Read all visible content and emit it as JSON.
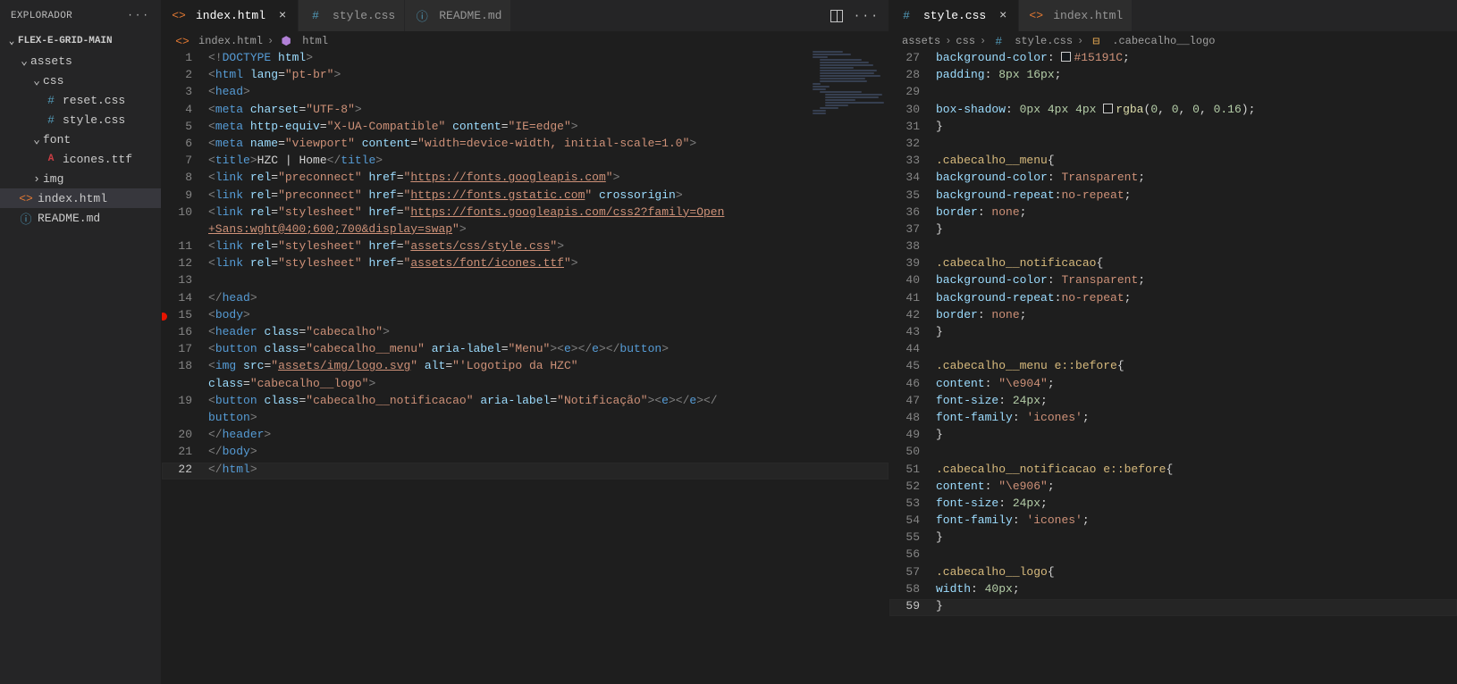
{
  "sidebar": {
    "title": "EXPLORADOR",
    "projectName": "FLEX-E-GRID-MAIN",
    "tree": [
      {
        "type": "folder",
        "name": "assets",
        "indent": 1,
        "open": true
      },
      {
        "type": "folder",
        "name": "css",
        "indent": 2,
        "open": true
      },
      {
        "type": "file",
        "name": "reset.css",
        "icon": "css",
        "indent": 3
      },
      {
        "type": "file",
        "name": "style.css",
        "icon": "css",
        "indent": 3
      },
      {
        "type": "folder",
        "name": "font",
        "indent": 2,
        "open": true
      },
      {
        "type": "file",
        "name": "icones.ttf",
        "icon": "font",
        "indent": 3
      },
      {
        "type": "folder",
        "name": "img",
        "indent": 2,
        "open": false
      },
      {
        "type": "file",
        "name": "index.html",
        "icon": "html",
        "indent": 1,
        "active": true
      },
      {
        "type": "file",
        "name": "README.md",
        "icon": "readme",
        "indent": 1
      }
    ]
  },
  "leftPane": {
    "tabs": [
      {
        "name": "index.html",
        "icon": "html",
        "active": true,
        "close": true
      },
      {
        "name": "style.css",
        "icon": "css",
        "active": false,
        "close": false
      },
      {
        "name": "README.md",
        "icon": "readme",
        "active": false,
        "close": false
      }
    ],
    "breadcrumb": [
      {
        "icon": "html",
        "text": "index.html"
      },
      {
        "icon": "cube",
        "text": "html"
      }
    ],
    "lines": [
      {
        "n": 1,
        "html": "<span class=t-gray>&lt;!</span><span class=t-blue>DOCTYPE</span> <span class=t-attr>html</span><span class=t-gray>&gt;</span>"
      },
      {
        "n": 2,
        "html": "<span class=t-gray>&lt;</span><span class=t-blue>html</span> <span class=t-attr>lang</span><span class=t-white>=</span><span class=t-str>\"pt-br\"</span><span class=t-gray>&gt;</span>"
      },
      {
        "n": 3,
        "html": "<span class=t-gray>&lt;</span><span class=t-blue>head</span><span class=t-gray>&gt;</span>"
      },
      {
        "n": 4,
        "html": "    <span class=t-gray>&lt;</span><span class=t-blue>meta</span> <span class=t-attr>charset</span><span class=t-white>=</span><span class=t-str>\"UTF-8\"</span><span class=t-gray>&gt;</span>"
      },
      {
        "n": 5,
        "html": "    <span class=t-gray>&lt;</span><span class=t-blue>meta</span> <span class=t-attr>http-equiv</span><span class=t-white>=</span><span class=t-str>\"X-UA-Compatible\"</span> <span class=t-attr>content</span><span class=t-white>=</span><span class=t-str>\"IE=edge\"</span><span class=t-gray>&gt;</span>"
      },
      {
        "n": 6,
        "html": "    <span class=t-gray>&lt;</span><span class=t-blue>meta</span> <span class=t-attr>name</span><span class=t-white>=</span><span class=t-str>\"viewport\"</span> <span class=t-attr>content</span><span class=t-white>=</span><span class=t-str>\"width=device-width, initial-scale=1.0\"</span><span class=t-gray>&gt;</span>"
      },
      {
        "n": 7,
        "html": "    <span class=t-gray>&lt;</span><span class=t-blue>title</span><span class=t-gray>&gt;</span><span class=t-white>HZC | Home</span><span class=t-gray>&lt;/</span><span class=t-blue>title</span><span class=t-gray>&gt;</span>"
      },
      {
        "n": 8,
        "html": "    <span class=t-gray>&lt;</span><span class=t-blue>link</span> <span class=t-attr>rel</span><span class=t-white>=</span><span class=t-str>\"preconnect\"</span> <span class=t-attr>href</span><span class=t-white>=</span><span class=t-str>\"</span><span class=t-link>https://fonts.googleapis.com</span><span class=t-str>\"</span><span class=t-gray>&gt;</span>"
      },
      {
        "n": 9,
        "html": "    <span class=t-gray>&lt;</span><span class=t-blue>link</span> <span class=t-attr>rel</span><span class=t-white>=</span><span class=t-str>\"preconnect\"</span> <span class=t-attr>href</span><span class=t-white>=</span><span class=t-str>\"</span><span class=t-link>https://fonts.gstatic.com</span><span class=t-str>\"</span> <span class=t-attr>crossorigin</span><span class=t-gray>&gt;</span>"
      },
      {
        "n": 10,
        "html": "    <span class=t-gray>&lt;</span><span class=t-blue>link</span> <span class=t-attr>rel</span><span class=t-white>=</span><span class=t-str>\"stylesheet\"</span> <span class=t-attr>href</span><span class=t-white>=</span><span class=t-str>\"</span><span class=t-link>https://fonts.googleapis.com/css2?family=Open</span>"
      },
      {
        "n": "",
        "html": "    <span class=t-link>+Sans:wght@400;600;700&amp;display=swap</span><span class=t-str>\"</span><span class=t-gray>&gt;</span>"
      },
      {
        "n": 11,
        "html": "    <span class=t-gray>&lt;</span><span class=t-blue>link</span> <span class=t-attr>rel</span><span class=t-white>=</span><span class=t-str>\"stylesheet\"</span> <span class=t-attr>href</span><span class=t-white>=</span><span class=t-str>\"</span><span class=t-link>assets/css/style.css</span><span class=t-str>\"</span><span class=t-gray>&gt;</span>"
      },
      {
        "n": 12,
        "html": "    <span class=t-gray>&lt;</span><span class=t-blue>link</span> <span class=t-attr>rel</span><span class=t-white>=</span><span class=t-str>\"stylesheet\"</span> <span class=t-attr>href</span><span class=t-white>=</span><span class=t-str>\"</span><span class=t-link>assets/font/icones.ttf</span><span class=t-str>\"</span><span class=t-gray>&gt;</span>"
      },
      {
        "n": 13,
        "html": ""
      },
      {
        "n": 14,
        "html": "<span class=t-gray>&lt;/</span><span class=t-blue>head</span><span class=t-gray>&gt;</span>"
      },
      {
        "n": 15,
        "html": "<span class=t-gray>&lt;</span><span class=t-blue>body</span><span class=t-gray>&gt;</span>",
        "bp": true
      },
      {
        "n": 16,
        "html": "    <span class=t-gray>&lt;</span><span class=t-blue>header</span> <span class=t-attr>class</span><span class=t-white>=</span><span class=t-str>\"cabecalho\"</span><span class=t-gray>&gt;</span>"
      },
      {
        "n": 17,
        "html": "        <span class=t-gray>&lt;</span><span class=t-blue>button</span> <span class=t-attr>class</span><span class=t-white>=</span><span class=t-str>\"cabecalho__menu\"</span> <span class=t-attr>aria-label</span><span class=t-white>=</span><span class=t-str>\"Menu\"</span><span class=t-gray>&gt;&lt;</span><span class=t-blue>e</span><span class=t-gray>&gt;&lt;/</span><span class=t-blue>e</span><span class=t-gray>&gt;&lt;/</span><span class=t-blue>button</span><span class=t-gray>&gt;</span>"
      },
      {
        "n": 18,
        "html": "        <span class=t-gray>&lt;</span><span class=t-blue>img</span> <span class=t-attr>src</span><span class=t-white>=</span><span class=t-str>\"</span><span class=t-link>assets/img/logo.svg</span><span class=t-str>\"</span> <span class=t-attr>alt</span><span class=t-white>=</span><span class=t-str>\"'Logotipo da HZC\"</span> "
      },
      {
        "n": "",
        "html": "        <span class=t-attr>class</span><span class=t-white>=</span><span class=t-str>\"cabecalho__logo\"</span><span class=t-gray>&gt;</span>"
      },
      {
        "n": 19,
        "html": "        <span class=t-gray>&lt;</span><span class=t-blue>button</span> <span class=t-attr>class</span><span class=t-white>=</span><span class=t-str>\"cabecalho__notificacao\"</span> <span class=t-attr>aria-label</span><span class=t-white>=</span><span class=t-str>\"Notificação\"</span><span class=t-gray>&gt;&lt;</span><span class=t-blue>e</span><span class=t-gray>&gt;&lt;/</span><span class=t-blue>e</span><span class=t-gray>&gt;&lt;/</span>"
      },
      {
        "n": "",
        "html": "        <span class=t-blue>button</span><span class=t-gray>&gt;</span>"
      },
      {
        "n": 20,
        "html": "    <span class=t-gray>&lt;/</span><span class=t-blue>header</span><span class=t-gray>&gt;</span>"
      },
      {
        "n": 21,
        "html": "<span class=t-gray>&lt;/</span><span class=t-blue>body</span><span class=t-gray>&gt;</span>"
      },
      {
        "n": 22,
        "html": "<span class=t-gray>&lt;/</span><span class=t-blue>html</span><span class=t-gray>&gt;</span>",
        "cursor": true
      }
    ]
  },
  "rightPane": {
    "tabs": [
      {
        "name": "style.css",
        "icon": "css",
        "active": true,
        "close": true
      },
      {
        "name": "index.html",
        "icon": "html",
        "active": false,
        "close": false
      }
    ],
    "breadcrumb": [
      {
        "text": "assets"
      },
      {
        "text": "css"
      },
      {
        "icon": "css",
        "text": "style.css"
      },
      {
        "icon": "brace",
        "text": ".cabecalho__logo"
      }
    ],
    "lines": [
      {
        "n": 27,
        "html": "        <span class=t-prop>background-color</span><span class=t-white>: </span><span class='color-swatch' style='background:#15191C;'></span><span class=t-str>#15191C</span><span class=t-white>;</span>"
      },
      {
        "n": 28,
        "html": "        <span class=t-prop>padding</span><span class=t-white>: </span><span class=t-num>8px</span> <span class=t-num>16px</span><span class=t-white>;</span>"
      },
      {
        "n": 29,
        "html": ""
      },
      {
        "n": 30,
        "html": "        <span class=t-prop>box-shadow</span><span class=t-white>: </span><span class=t-num>0px</span> <span class=t-num>4px</span> <span class=t-num>4px</span> <span class='color-swatch' style='background:rgba(0,0,0,0.16);'></span><span class=t-func>rgba</span><span class=t-white>(</span><span class=t-num>0</span><span class=t-white>, </span><span class=t-num>0</span><span class=t-white>, </span><span class=t-num>0</span><span class=t-white>, </span><span class=t-num>0.16</span><span class=t-white>);</span>"
      },
      {
        "n": 31,
        "html": "    <span class=t-white>}</span>"
      },
      {
        "n": 32,
        "html": ""
      },
      {
        "n": 33,
        "html": "    <span class=t-sel>.cabecalho__menu</span><span class=t-white>{</span>"
      },
      {
        "n": 34,
        "html": "        <span class=t-prop>background-color</span><span class=t-white>: </span><span class=t-str>Transparent</span><span class=t-white>;</span>"
      },
      {
        "n": 35,
        "html": "        <span class=t-prop>background-repeat</span><span class=t-white>:</span><span class=t-str>no-repeat</span><span class=t-white>;</span>"
      },
      {
        "n": 36,
        "html": "        <span class=t-prop>border</span><span class=t-white>: </span><span class=t-str>none</span><span class=t-white>;</span>"
      },
      {
        "n": 37,
        "html": "    <span class=t-white>}</span>"
      },
      {
        "n": 38,
        "html": ""
      },
      {
        "n": 39,
        "html": "    <span class=t-sel>.cabecalho__notificacao</span><span class=t-white>{</span>"
      },
      {
        "n": 40,
        "html": "        <span class=t-prop>background-color</span><span class=t-white>: </span><span class=t-str>Transparent</span><span class=t-white>;</span>"
      },
      {
        "n": 41,
        "html": "        <span class=t-prop>background-repeat</span><span class=t-white>:</span><span class=t-str>no-repeat</span><span class=t-white>;</span>"
      },
      {
        "n": 42,
        "html": "        <span class=t-prop>border</span><span class=t-white>: </span><span class=t-str>none</span><span class=t-white>;</span>"
      },
      {
        "n": 43,
        "html": "    <span class=t-white>}</span>"
      },
      {
        "n": 44,
        "html": ""
      },
      {
        "n": 45,
        "html": "    <span class=t-sel>.cabecalho__menu e::before</span><span class=t-white>{</span>"
      },
      {
        "n": 46,
        "html": "        <span class=t-prop>content</span><span class=t-white>: </span><span class=t-str>\"\\e904\"</span><span class=t-white>;</span>"
      },
      {
        "n": 47,
        "html": "        <span class=t-prop>font-size</span><span class=t-white>: </span><span class=t-num>24px</span><span class=t-white>;</span>"
      },
      {
        "n": 48,
        "html": "        <span class=t-prop>font-family</span><span class=t-white>: </span><span class=t-str>'icones'</span><span class=t-white>;</span>"
      },
      {
        "n": 49,
        "html": "    <span class=t-white>}</span>"
      },
      {
        "n": 50,
        "html": ""
      },
      {
        "n": 51,
        "html": "    <span class=t-sel>.cabecalho__notificacao e::before</span><span class=t-white>{</span>"
      },
      {
        "n": 52,
        "html": "        <span class=t-prop>content</span><span class=t-white>: </span><span class=t-str>\"\\e906\"</span><span class=t-white>;</span>"
      },
      {
        "n": 53,
        "html": "        <span class=t-prop>font-size</span><span class=t-white>: </span><span class=t-num>24px</span><span class=t-white>;</span>"
      },
      {
        "n": 54,
        "html": "        <span class=t-prop>font-family</span><span class=t-white>: </span><span class=t-str>'icones'</span><span class=t-white>;</span>"
      },
      {
        "n": 55,
        "html": "    <span class=t-white>}</span>"
      },
      {
        "n": 56,
        "html": ""
      },
      {
        "n": 57,
        "html": "    <span class=t-sel>.cabecalho__logo</span><span class=t-white>{</span>"
      },
      {
        "n": 58,
        "html": "        <span class=t-prop>width</span><span class=t-white>: </span><span class=t-num>40px</span><span class=t-white>;</span>"
      },
      {
        "n": 59,
        "html": "    <span class=t-white>}</span>",
        "cursor": true
      }
    ]
  }
}
